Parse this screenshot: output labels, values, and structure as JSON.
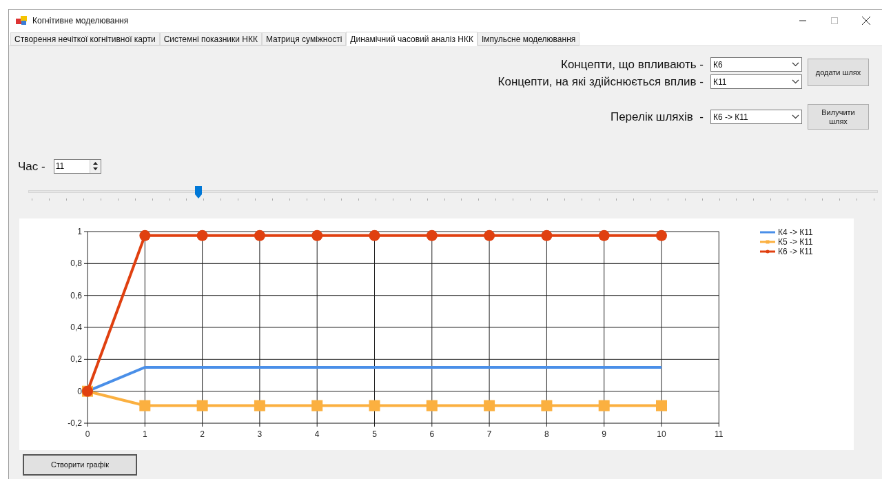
{
  "window": {
    "title": "Когнітивне моделювання"
  },
  "tabs": [
    {
      "label": "Створення нечіткої когнітивної карти",
      "selected": false
    },
    {
      "label": "Системні показники НКК",
      "selected": false
    },
    {
      "label": "Матриця суміжності",
      "selected": false
    },
    {
      "label": "Динамічний часовий аналіз НКК",
      "selected": true
    },
    {
      "label": "Імпульсне моделювання",
      "selected": false
    }
  ],
  "influencing": {
    "label": "Концепти, що впливають -",
    "value": "К6"
  },
  "influenced": {
    "label": "Концепти, на які здійснюється вплив -",
    "value": "К11"
  },
  "add_button": "додати шлях",
  "paths": {
    "label": "Перелік шляхів  -",
    "value": "К6 -> К11"
  },
  "remove_button": "Вилучити шлях",
  "time": {
    "label": "Час -",
    "value": "11"
  },
  "slider": {
    "level": 0.2
  },
  "chart": {
    "chart_data": {
      "type": "line",
      "grid": true,
      "legend": true,
      "x": [
        0,
        1,
        2,
        3,
        4,
        5,
        6,
        7,
        8,
        9,
        10
      ],
      "xlim": [
        0,
        11
      ],
      "ylim": [
        -0.2,
        1
      ],
      "xticks": [
        0,
        1,
        2,
        3,
        4,
        5,
        6,
        7,
        8,
        9,
        10,
        11
      ],
      "yticks": [
        {
          "value": -0.2,
          "label": "-0,2"
        },
        {
          "value": 0,
          "label": "0"
        },
        {
          "value": 0.2,
          "label": "0,2"
        },
        {
          "value": 0.4,
          "label": "0,4"
        },
        {
          "value": 0.6,
          "label": "0,6"
        },
        {
          "value": 0.8,
          "label": "0,8"
        },
        {
          "value": 1,
          "label": "1"
        }
      ],
      "series": [
        {
          "name": "К4 -> К11",
          "color": "#4a8fe8",
          "marker": "none",
          "values": [
            0,
            0.15,
            0.15,
            0.15,
            0.15,
            0.15,
            0.15,
            0.15,
            0.15,
            0.15,
            0.15
          ]
        },
        {
          "name": "К5 -> К11",
          "color": "#fbb040",
          "marker": "square",
          "values": [
            0,
            -0.09,
            -0.09,
            -0.09,
            -0.09,
            -0.09,
            -0.09,
            -0.09,
            -0.09,
            -0.09,
            -0.09
          ]
        },
        {
          "name": "К6 -> К11",
          "color": "#e04010",
          "marker": "circle",
          "values": [
            0,
            0.975,
            0.975,
            0.975,
            0.975,
            0.975,
            0.975,
            0.975,
            0.975,
            0.975,
            0.975
          ]
        }
      ]
    }
  },
  "create_button": "Створити графік"
}
